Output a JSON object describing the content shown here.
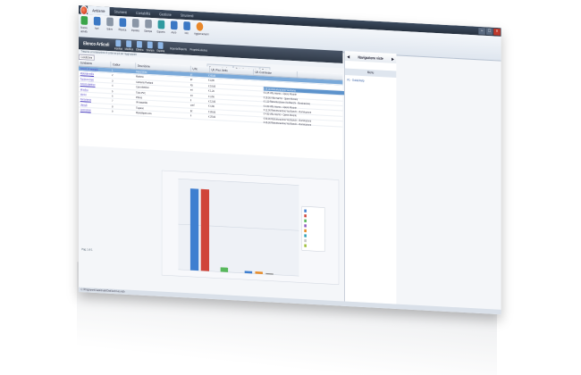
{
  "window": {
    "tabs": [
      "Ambiente",
      "Strumenti",
      "Contabilità",
      "Gestione",
      "Strumenti"
    ],
    "active_tab_index": 0,
    "controls": [
      "–",
      "□",
      "×"
    ]
  },
  "ribbon": {
    "buttons": [
      {
        "label": "Nuova attività",
        "icon": "new-icon",
        "color": "green"
      },
      {
        "label": "Apri",
        "icon": "open-icon",
        "color": "blue"
      },
      {
        "label": "Salva",
        "icon": "save-icon",
        "color": "grey"
      },
      {
        "label": "Ricerca",
        "icon": "search-icon",
        "color": "blue"
      },
      {
        "label": "Imposta",
        "icon": "settings-icon",
        "color": "grey"
      },
      {
        "label": "Stampa",
        "icon": "print-icon",
        "color": "grey"
      },
      {
        "label": "Esporta",
        "icon": "export-icon",
        "color": "teal"
      },
      {
        "label": "Aiuto",
        "icon": "help-icon",
        "color": "blue"
      },
      {
        "label": "Info",
        "icon": "info-icon",
        "color": "blue"
      },
      {
        "label": "Aggiornamenti",
        "icon": "update-icon",
        "color": "orange"
      }
    ]
  },
  "panel": {
    "title": "Elenco Articoli",
    "actions": [
      "Inserisci",
      "Modifica",
      "Elimina",
      "Stampa",
      "Esporta"
    ],
    "links": [
      "Importa/Esporta",
      "Proprietà elenco"
    ],
    "subtitle": "Trascina un'intestazione di colonna qui per raggruppare",
    "filter_label": "Condizione",
    "category_select": "Tutte le categorie",
    "category_mode": "Tutte"
  },
  "grid": {
    "columns": [
      "Condizione",
      "Codice",
      "Descrizione",
      "U.M.",
      "Prezzo netto Acq."
    ],
    "price_headers": [
      "Prezzo netto Acq.",
      "Ult. Prez. Netto",
      "Ult. Commesse"
    ],
    "rows": [
      [
        "Articolo di esempio",
        "1",
        "Descrizione",
        "pz",
        "€ 45,00"
      ],
      [
        "Materiale edile",
        "2",
        "Mattone",
        "pz",
        "€ 0,65"
      ],
      [
        "Fornitura base",
        "3",
        "Cemento Portland",
        "kg",
        "€ 18,00"
      ],
      [
        "Articolo elettrico",
        "4",
        "Cavo elettrico",
        "mt",
        "€ 1,20"
      ],
      [
        "Idraulica",
        "5",
        "Tubo PVC",
        "mt",
        "€ 3,50"
      ],
      [
        "Vernici",
        "6",
        "Pittura",
        "lt",
        "€ 12,00"
      ],
      [
        "Ferramenta",
        "7",
        "Viti assortite",
        "conf",
        "€ 4,80"
      ],
      [
        "Utensili",
        "8",
        "Trapano",
        "pz",
        "€ 89,00"
      ],
      [
        "Lavorazioni",
        "9",
        "Manodopera ora",
        "h",
        "€ 25,00"
      ]
    ],
    "notes": [
      "€ 45,00 Ristrutturazione Via Roma",
      "€ 0,65 Villa marmo - Opere Murarie",
      "€ 18,00 Villa marmo - Opere Murarie",
      "€ 1,20 Ristrutturazione Via Bianchi - Illuminazione",
      "€ 3,50 Villa marmo - Opere Murarie",
      "€ 12,00 Ristrutturazione Via Bianchi - Illuminazione",
      "€ 4,80 Villa marmo - Opere Murarie",
      "€ 89,00 Ristrutturazione Via Bianchi - Illuminazione",
      "€ 25,00 Ristrutturazione Via Bianchi - Illuminazione"
    ]
  },
  "sidebar": {
    "title": "Navigazione viste",
    "menu": "Menu",
    "items": [
      "F1 - Guida/Help"
    ]
  },
  "chart_data": {
    "type": "bar",
    "categories": [
      "",
      "",
      "",
      "",
      "",
      ""
    ],
    "series": [
      {
        "name": "",
        "values": [
          45,
          45,
          2.5,
          1.2,
          1.2,
          0.6
        ],
        "color": [
          "#3f7fd0",
          "#d0453a",
          "#58b85c",
          "#3f7fd0",
          "#e88c2a",
          "#8a8a8a"
        ]
      }
    ],
    "legend": [
      "",
      "",
      "",
      "",
      "",
      "",
      "",
      ""
    ],
    "legend_colors": [
      "#3f7fd0",
      "#d0453a",
      "#58b85c",
      "#8e5bbf",
      "#e88c2a",
      "#2fa0b6",
      "#c8c8c8",
      "#9fbf3b"
    ],
    "ylim": [
      0,
      50
    ],
    "grid": true,
    "legend_position": "right"
  },
  "status": {
    "pager": "Pag. 1 di 1",
    "text": "C:\\Programmi\\Gestionale\\Dati\\Archivio.mdb"
  }
}
